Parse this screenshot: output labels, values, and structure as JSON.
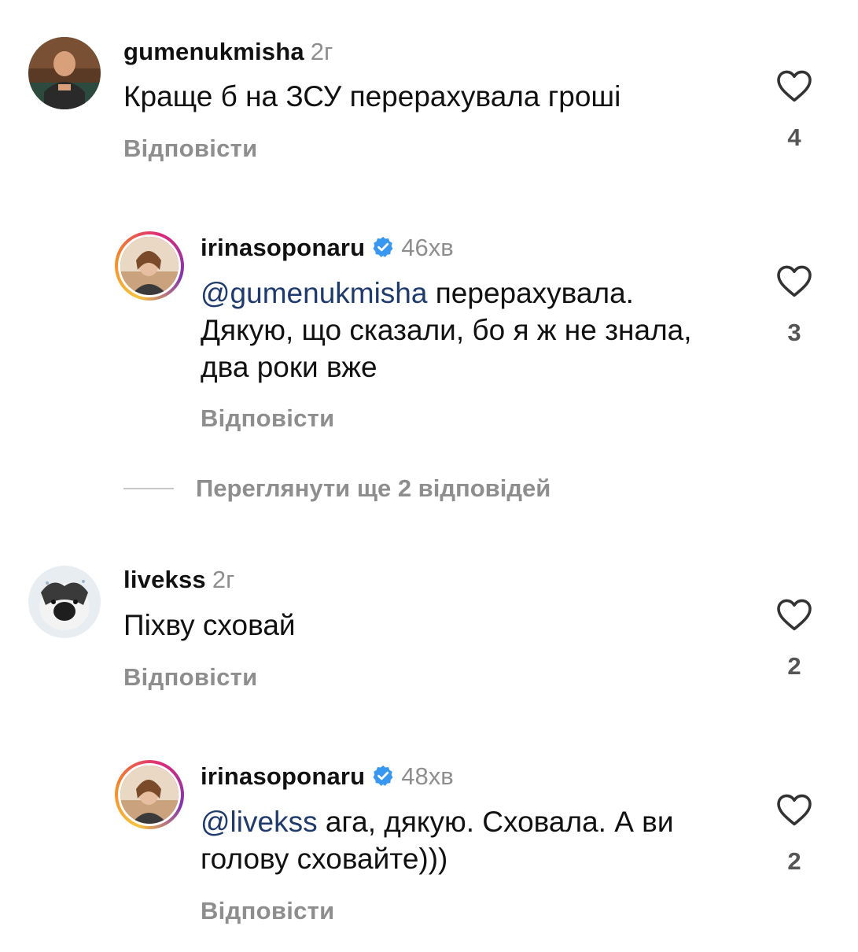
{
  "comments": [
    {
      "username": "gumenukmisha",
      "time": "2г",
      "text": "Краще б на ЗСУ перерахувала гроші",
      "reply_label": "Відповісти",
      "likes": "4"
    },
    {
      "username": "irinasoponaru",
      "verified": true,
      "time": "46хв",
      "mention": "@gumenukmisha",
      "text": " перерахувала. Дякую, що сказали, бо я ж не знала, два роки вже",
      "reply_label": "Відповісти",
      "likes": "3"
    },
    {
      "username": "livekss",
      "time": "2г",
      "text": "Піхву сховай",
      "reply_label": "Відповісти",
      "likes": "2"
    },
    {
      "username": "irinasoponaru",
      "verified": true,
      "time": "48хв",
      "mention": "@livekss",
      "text": " ага, дякую. Сховала. А ви голову сховайте)))",
      "reply_label": "Відповісти",
      "likes": "2"
    }
  ],
  "view_more_replies": "Переглянути ще 2 відповідей",
  "colors": {
    "text": "#111111",
    "secondary": "#8e8e8e",
    "mention": "#1f3a6d",
    "verified": "#3897f0"
  },
  "icons": {
    "like": "heart-outline-icon",
    "verified": "verified-badge-icon"
  }
}
